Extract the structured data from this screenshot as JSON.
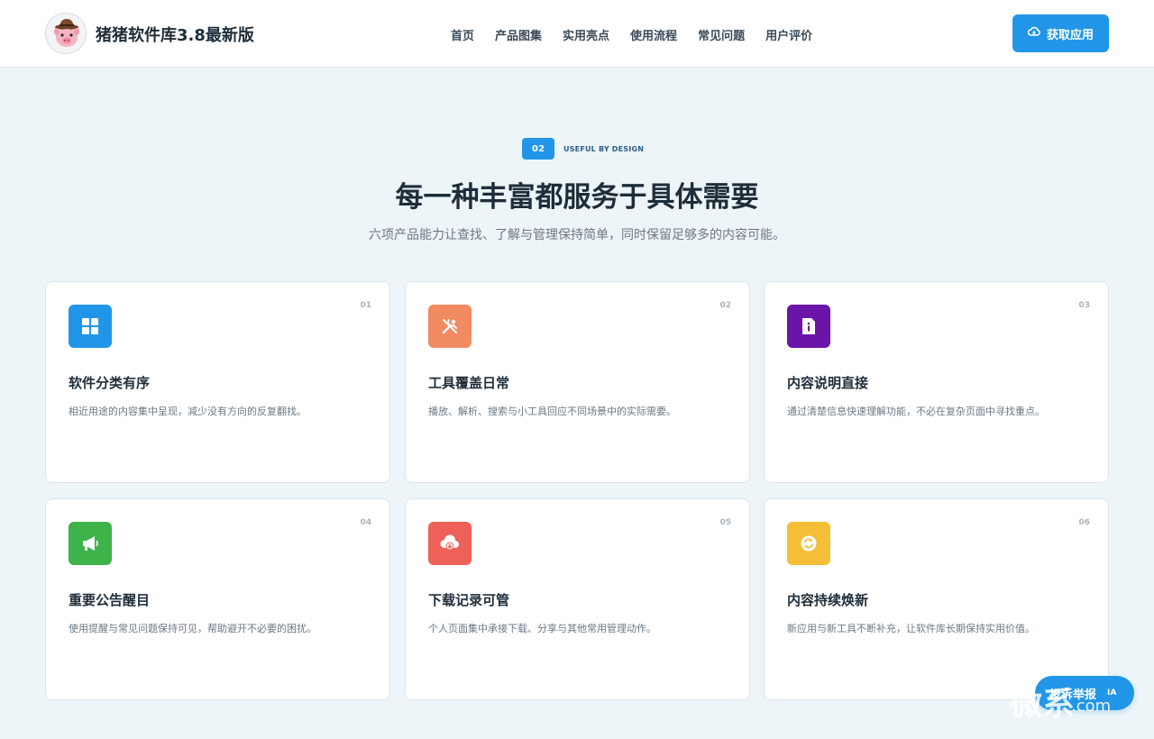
{
  "header": {
    "brand": "猪猪软件库3.8最新版",
    "nav": [
      "首页",
      "产品图集",
      "实用亮点",
      "使用流程",
      "常见问题",
      "用户评价"
    ],
    "cta_label": "获取应用"
  },
  "section": {
    "number": "02",
    "eyebrow": "USEFUL BY DESIGN",
    "title": "每一种丰富都服务于具体需要",
    "subtitle": "六项产品能力让查找、了解与管理保持简单，同时保留足够多的内容可能。"
  },
  "cards": [
    {
      "num": "01",
      "title": "软件分类有序",
      "desc": "相近用途的内容集中呈现，减少没有方向的反复翻找。",
      "icon": "grid-icon",
      "color": "#2196e8"
    },
    {
      "num": "02",
      "title": "工具覆盖日常",
      "desc": "播放、解析、搜索与小工具回应不同场景中的实际需要。",
      "icon": "tools-icon",
      "color": "#f28a62"
    },
    {
      "num": "03",
      "title": "内容说明直接",
      "desc": "通过清楚信息快速理解功能，不必在复杂页面中寻找重点。",
      "icon": "info-doc-icon",
      "color": "#6a14a8"
    },
    {
      "num": "04",
      "title": "重要公告醒目",
      "desc": "使用提醒与常见问题保持可见，帮助避开不必要的困扰。",
      "icon": "megaphone-icon",
      "color": "#3db34a"
    },
    {
      "num": "05",
      "title": "下载记录可管",
      "desc": "个人页面集中承接下载、分享与其他常用管理动作。",
      "icon": "cloud-download-icon",
      "color": "#ee6159"
    },
    {
      "num": "06",
      "title": "内容持续焕新",
      "desc": "新应用与新工具不断补充，让软件库长期保持实用价值。",
      "icon": "refresh-icon",
      "color": "#f4bf36"
    }
  ],
  "float_button": {
    "label": "投诉举报",
    "tail": "IA"
  },
  "watermark": {
    "text": "微系",
    "sub": ".com"
  }
}
